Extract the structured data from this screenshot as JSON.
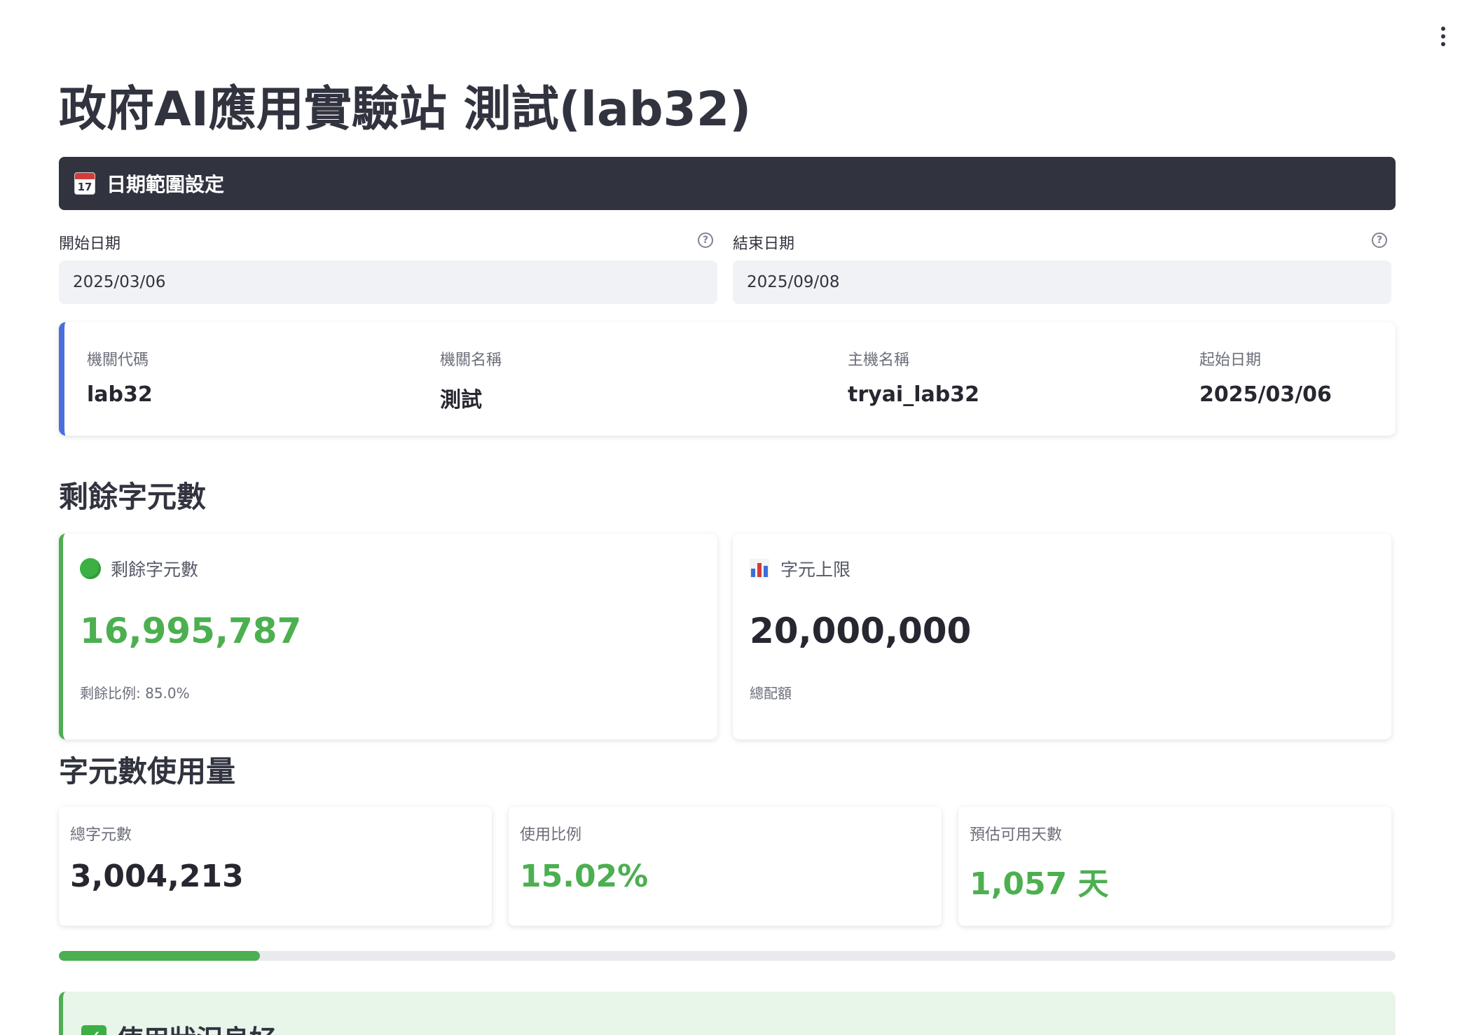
{
  "page": {
    "title": "政府AI應用實驗站 測試(lab32)"
  },
  "date_section": {
    "icon": "calendar-icon",
    "calendar_day": "17",
    "label": "日期範圍設定",
    "start_label": "開始日期",
    "start_value": "2025/03/06",
    "end_label": "結束日期",
    "end_value": "2025/09/08"
  },
  "info": {
    "accent_color": "#4a6fdc",
    "items": [
      {
        "key": "機關代碼",
        "value": "lab32"
      },
      {
        "key": "機關名稱",
        "value": "測試"
      },
      {
        "key": "主機名稱",
        "value": "tryai_lab32"
      },
      {
        "key": "起始日期",
        "value": "2025/03/06"
      }
    ]
  },
  "remaining": {
    "heading": "剩餘字元數",
    "remaining_card": {
      "icon": "green-circle-icon",
      "label": "剩餘字元數",
      "value": "16,995,787",
      "sub": "剩餘比例: 85.0%",
      "color": "#4caf50"
    },
    "limit_card": {
      "icon": "bar-chart-icon",
      "label": "字元上限",
      "value": "20,000,000",
      "sub": "總配額"
    }
  },
  "usage": {
    "heading": "字元數使用量",
    "cards": [
      {
        "label": "總字元數",
        "value": "3,004,213",
        "color": "#262730"
      },
      {
        "label": "使用比例",
        "value": "15.02%",
        "color": "#4caf50"
      },
      {
        "label": "預估可用天數",
        "value": "1,057 天",
        "color": "#4caf50"
      }
    ],
    "progress_fraction": 0.1502,
    "progress_color": "#4caf50"
  },
  "status": {
    "icon": "check-mark-icon",
    "text": "使用狀況良好"
  }
}
